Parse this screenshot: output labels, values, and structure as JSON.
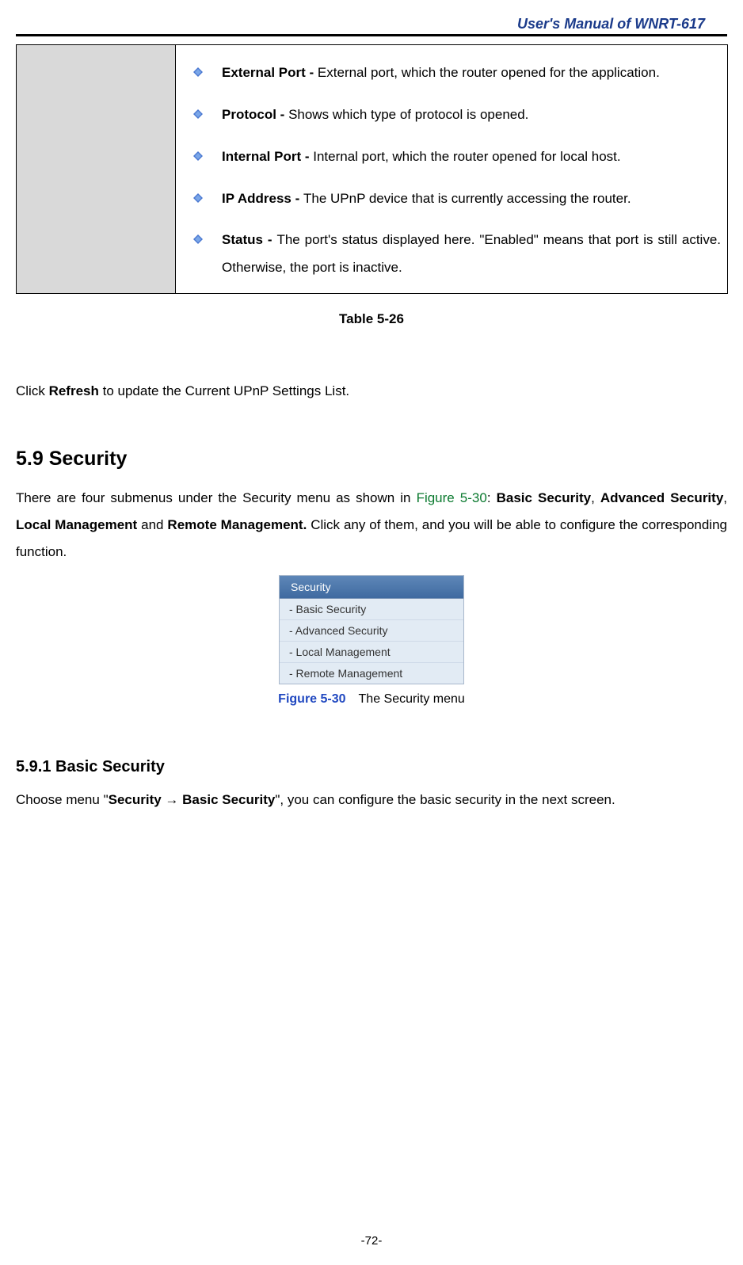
{
  "header": {
    "title": "User's Manual of WNRT-617"
  },
  "table": {
    "items": [
      {
        "term": "External Port - ",
        "desc": "External port, which the router opened for the application."
      },
      {
        "term": "Protocol - ",
        "desc": "Shows which type of protocol is opened."
      },
      {
        "term": "Internal Port - ",
        "desc": "Internal port, which the router opened for local host."
      },
      {
        "term": "IP Address - ",
        "desc": "The UPnP device that is currently accessing the router."
      },
      {
        "term": "Status - ",
        "desc": "The port's status displayed here. \"Enabled\" means that port is still active. Otherwise, the port is inactive."
      }
    ],
    "caption": "Table 5-26"
  },
  "refresh": {
    "pre": "Click ",
    "bold": "Refresh",
    "post": " to update the Current UPnP Settings List."
  },
  "section": {
    "heading": "5.9  Security",
    "p1a": "There are four submenus under the Security menu as shown in ",
    "p1link": "Figure 5-30",
    "p1b": ": ",
    "bs": "Basic Security",
    "comma1": ", ",
    "as": "Advanced Security",
    "comma2": ", ",
    "lm": "Local Management",
    "and": " and ",
    "rm": "Remote Management.",
    "p1c": " Click any of them, and you will be able to configure the corresponding function."
  },
  "menu": {
    "header": "Security",
    "items": [
      "- Basic Security",
      "- Advanced Security",
      "- Local Management",
      "- Remote Management"
    ]
  },
  "figure": {
    "label": "Figure 5-30",
    "caption": "The Security menu"
  },
  "subsection": {
    "heading": "5.9.1  Basic Security",
    "pre": "Choose menu \"",
    "b1": "Security",
    "arrow": " → ",
    "b2": "Basic Security",
    "post": "\", you can configure the basic security in the next screen."
  },
  "pagenum": "-72-"
}
